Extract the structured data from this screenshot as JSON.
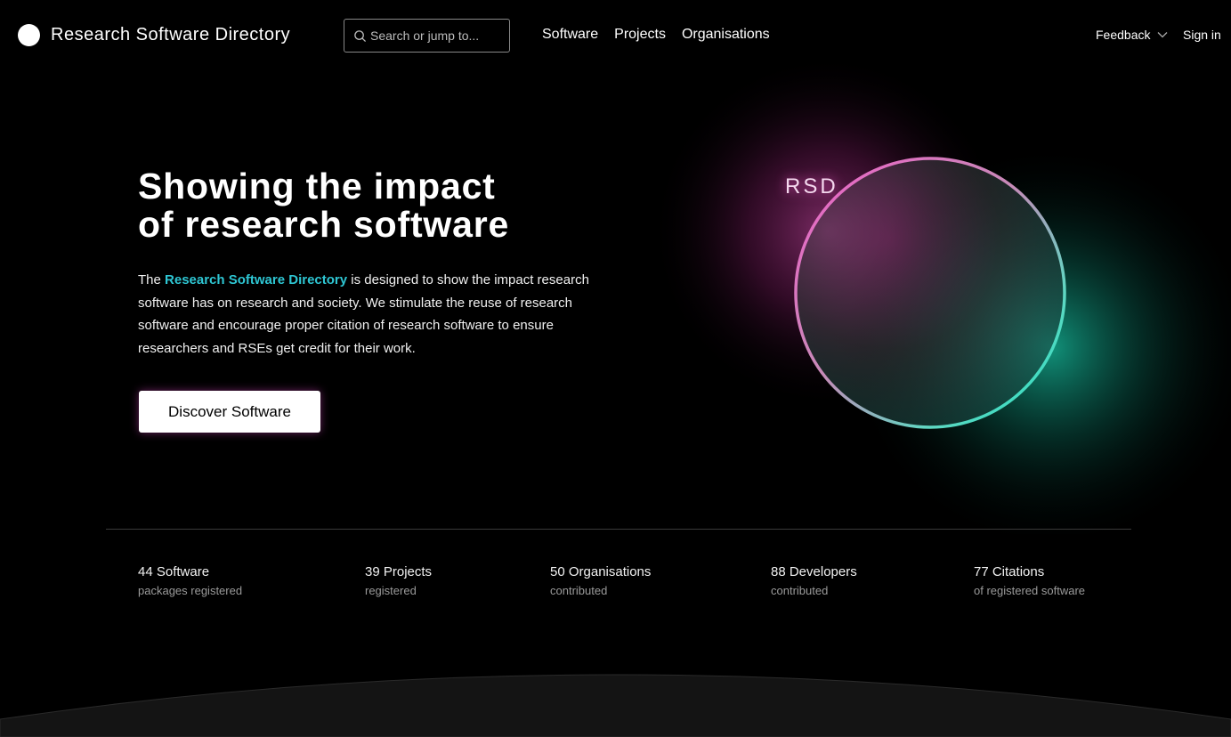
{
  "header": {
    "brand": "Research Software Directory",
    "search_placeholder": "Search or jump to...",
    "nav": [
      "Software",
      "Projects",
      "Organisations"
    ],
    "feedback": "Feedback",
    "sign_in": "Sign in"
  },
  "hero": {
    "title_line1": "Showing the impact",
    "title_line2": "of research software",
    "text_prefix": "The ",
    "text_link": "Research Software Directory",
    "text_suffix": " is designed to show the impact research software has on research and society. We stimulate the reuse of research software and encourage proper citation of research software to ensure researchers and RSEs get credit for their work.",
    "cta": "Discover Software",
    "art_label": "RSD"
  },
  "stats": [
    {
      "count": "44 Software",
      "caption": "packages registered"
    },
    {
      "count": "39 Projects",
      "caption": "registered"
    },
    {
      "count": "50 Organisations",
      "caption": "contributed"
    },
    {
      "count": "88 Developers",
      "caption": "contributed"
    },
    {
      "count": "77 Citations",
      "caption": "of registered software"
    }
  ],
  "colors": {
    "accent_link": "#2ec6d3",
    "glow_pink": "#e24fb8",
    "glow_teal": "#19d2b0",
    "background": "#000000"
  },
  "icons": {
    "search": "search-icon",
    "feedback_caret": "chevron-down-icon",
    "logo": "logo-circle-icon"
  }
}
